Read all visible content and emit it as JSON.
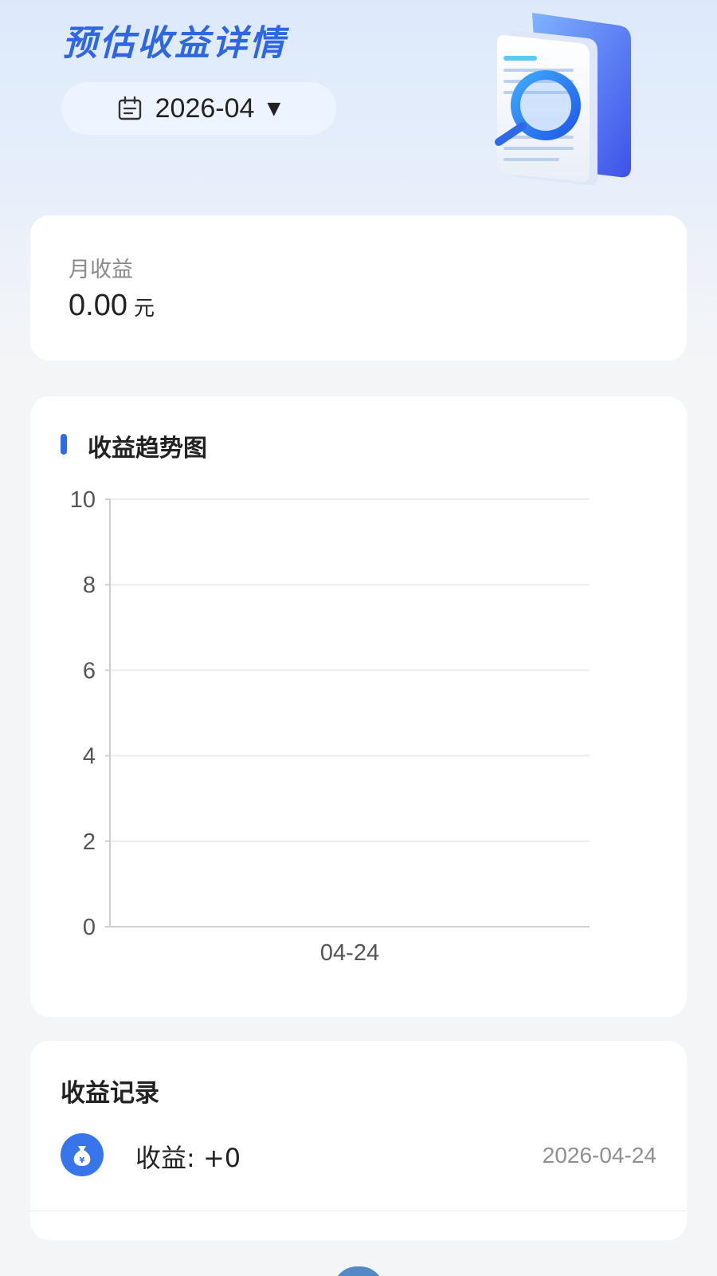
{
  "header": {
    "title": "预估收益详情",
    "month_picker": {
      "value": "2026-04",
      "icon": "calendar-icon",
      "caret": "▼"
    },
    "illustration": "document-search-illustration"
  },
  "summary": {
    "label": "月收益",
    "amount": "0.00",
    "unit": "元"
  },
  "trend": {
    "title": "收益趋势图"
  },
  "chart_data": {
    "type": "line",
    "categories": [
      "04-24"
    ],
    "series": [
      {
        "values": [
          0
        ]
      }
    ],
    "y_ticks": [
      "0",
      "2",
      "4",
      "6",
      "8",
      "10"
    ],
    "ylim": [
      0,
      10
    ],
    "grid": true
  },
  "records": {
    "title": "收益记录",
    "items": [
      {
        "label": "收益: +0",
        "date": "2026-04-24",
        "icon": "money-bag-icon"
      }
    ]
  },
  "colors": {
    "accent": "#2f6ae6",
    "title_blue": "#2f67e0",
    "icon_blue": "#3874ea",
    "background": "#f4f5f7"
  }
}
